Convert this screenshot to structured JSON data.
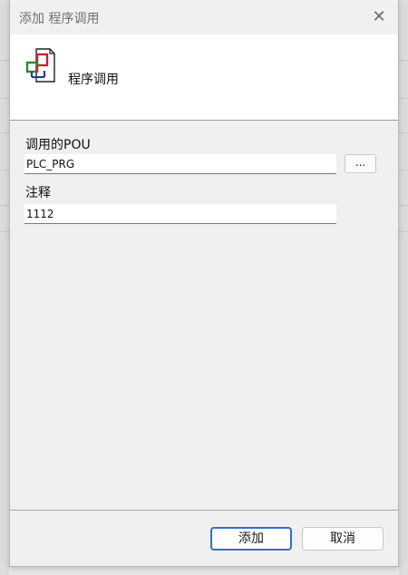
{
  "window": {
    "title": "添加 程序调用",
    "close_glyph": "✕"
  },
  "header": {
    "title": "程序调用",
    "icon": "program-call-icon"
  },
  "form": {
    "called_pou_label": "调用的POU",
    "called_pou_value": "PLC_PRG",
    "browse_label": "...",
    "comment_label": "注释",
    "comment_value": "1112"
  },
  "buttons": {
    "add_label": "添加",
    "cancel_label": "取消"
  },
  "colors": {
    "accent": "#2f6fd1",
    "icon_red": "#c0262d",
    "icon_green": "#2b8a2b",
    "icon_blue": "#1f3fa0"
  }
}
